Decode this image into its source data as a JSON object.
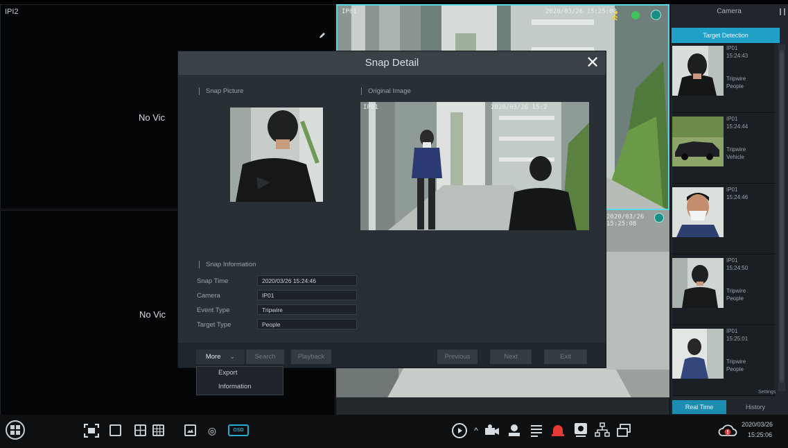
{
  "tiles": {
    "tile1_label": "IPI2",
    "no_video": "No Vic",
    "camera_overlay_id": "IP01",
    "camera_overlay_time": "2020/03/26 15:25:08",
    "tile4_time": "2020/03/26 15:25:08"
  },
  "panel": {
    "title": "Camera",
    "tab": "Target Detection",
    "cards": [
      {
        "cam": "IP01",
        "time": "15:24:43",
        "event": "Tripwire",
        "type": "People"
      },
      {
        "cam": "IP01",
        "time": "15:24:44",
        "event": "Tripwire",
        "type": "Vehicle"
      },
      {
        "cam": "IP01",
        "time": "15:24:46",
        "event": "",
        "type": ""
      },
      {
        "cam": "IP01",
        "time": "15:24:50",
        "event": "Tripwire",
        "type": "People"
      },
      {
        "cam": "IP01",
        "time": "15:25:01",
        "event": "Tripwire",
        "type": "People"
      }
    ],
    "settings": "Settings",
    "realtime": "Real Time",
    "history": "History"
  },
  "dialog": {
    "title": "Snap Detail",
    "close": "✕",
    "snap_picture": "Snap Picture",
    "original_image": "Original Image",
    "orig_overlay_id": "IP01",
    "orig_overlay_time": "2020/03/26 15:2",
    "snap_information": "Snap Information",
    "snap_time_label": "Snap Time",
    "snap_time_value": "2020/03/26 15:24:46",
    "camera_label": "Camera",
    "camera_value": "IP01",
    "event_type_label": "Event Type",
    "event_type_value": "Tripwire",
    "target_type_label": "Target Type",
    "target_type_value": "People"
  },
  "footer": {
    "more": "More",
    "search": "Search",
    "playback": "Playback",
    "previous": "Previous",
    "next": "Next",
    "exit": "Exit"
  },
  "more_menu": [
    "Export",
    "Information"
  ],
  "taskbar": {
    "osd": "OSD",
    "date": "2020/03/26",
    "time": "15:25:06"
  },
  "colors": {
    "accent": "#1fa1c7",
    "dialog_bg": "#283036",
    "alarm": "#e53935"
  },
  "icons": [
    "start-menu-icon",
    "fullscreen-icon",
    "layout-1-icon",
    "layout-4-icon",
    "layout-9-icon",
    "image-icon",
    "ptz-icon",
    "osd-icon",
    "playback-icon",
    "chevron-up-icon",
    "record-icon",
    "user-icon",
    "list-icon",
    "alarm-icon",
    "disk-icon",
    "network-icon",
    "windows-icon",
    "cloud-alert-icon",
    "pen-icon",
    "run-icon",
    "status-dot-icon",
    "cam-settings-icon",
    "close-icon",
    "chevron-down-icon"
  ]
}
